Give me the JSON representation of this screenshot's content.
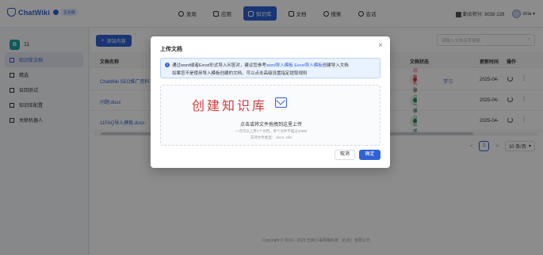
{
  "app": {
    "name": "ChatWiki",
    "version_badge": "企业版"
  },
  "nav": [
    {
      "label": "发现",
      "icon": "discover-icon"
    },
    {
      "label": "应用",
      "icon": "app-icon"
    },
    {
      "label": "知识库",
      "icon": "library-icon",
      "active": true
    },
    {
      "label": "文档",
      "icon": "doc-icon"
    },
    {
      "label": "搜索",
      "icon": "search-icon"
    },
    {
      "label": "会话",
      "icon": "chat-icon"
    }
  ],
  "user": {
    "points_label": "勤余积分: 9038 228",
    "name": "shia"
  },
  "library": {
    "icon_letter": "B",
    "name": "11"
  },
  "sidebar": [
    {
      "label": "知识库文档",
      "active": true
    },
    {
      "label": "精选"
    },
    {
      "label": "召回测试"
    },
    {
      "label": "知识库配置"
    },
    {
      "label": "关联机器人"
    }
  ],
  "toolbar": {
    "add_label": "添加内容",
    "search_placeholder": "请输入文档名称搜索"
  },
  "table": {
    "headers": {
      "name": "文档名称",
      "status": "文档状态",
      "time": "更新时间",
      "actions": "操作"
    },
    "rows": [
      {
        "name": "ChatWiki SEO推广资料",
        "status": "切换失败",
        "status_kind": "fail",
        "extra_link": "学习",
        "time": "2025-04-"
      },
      {
        "name": "问题.docx",
        "status": "学习完成",
        "status_kind": "ok",
        "time": "2025-04-"
      },
      {
        "name": "11FAQ导入模板.docx",
        "status": "学习完成",
        "status_kind": "ok",
        "time": "2025-04-"
      }
    ]
  },
  "pager": {
    "prev": "<",
    "current": "1",
    "next": ">",
    "page_size": "10 条/页"
  },
  "footer": {
    "copyright": "Copyright © 2019 - 2025 芝麻小事网络科技（北京）有限公司"
  },
  "modal": {
    "title": "上传文档",
    "alert_line1_a": "通过word或者Excel形式导入问答对，建议您参考",
    "alert_link1": "word导入模板",
    "alert_link2": "Excel导入模板",
    "alert_line1_b": "创建导入文档",
    "alert_line2": "如果您不是使用导入模板创建的文档，可以点击高级设置指定提取规则",
    "dropzone_title": "创建知识库",
    "dropzone_main": "点击或将文件拖拽到这里上传",
    "dropzone_hint1": "一次可以上传1个文档，单个文件不超过100M",
    "dropzone_hint2": "支持文件类型：.docx .xlsx",
    "cancel_label": "取消",
    "ok_label": "确定"
  },
  "colors": {
    "accent": "#2f62d6",
    "danger": "#d23c3c",
    "success": "#238a4a"
  }
}
